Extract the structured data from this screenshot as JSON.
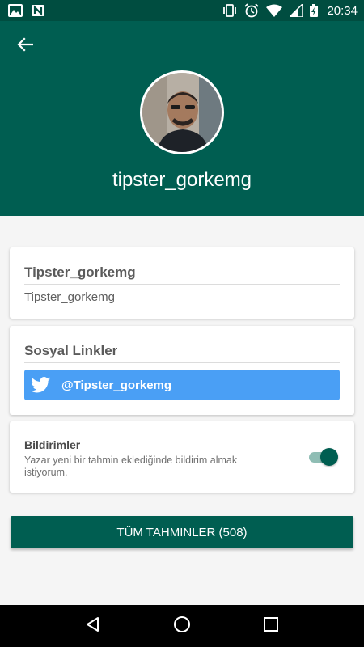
{
  "status_bar": {
    "time": "20:34",
    "icons": [
      "image-icon",
      "n-icon",
      "vibrate-icon",
      "alarm-icon",
      "wifi-icon",
      "signal-icon",
      "battery-charging-icon"
    ]
  },
  "header": {
    "username": "tipster_gorkemg",
    "background_color": "#005e51"
  },
  "profile_card": {
    "title": "Tipster_gorkemg",
    "value": "Tipster_gorkemg"
  },
  "social_card": {
    "title": "Sosyal Linkler",
    "twitter_handle": "@Tipster_gorkemg",
    "twitter_color": "#4a9ff5"
  },
  "notifications_card": {
    "title": "Bildirimler",
    "description": "Yazar yeni bir tahmin eklediğinde bildirim almak istiyorum.",
    "enabled": true
  },
  "all_predictions_button": {
    "label": "TÜM TAHMINLER (508)"
  },
  "nav_bar": {
    "buttons": [
      "back-icon",
      "home-icon",
      "recents-icon"
    ]
  }
}
